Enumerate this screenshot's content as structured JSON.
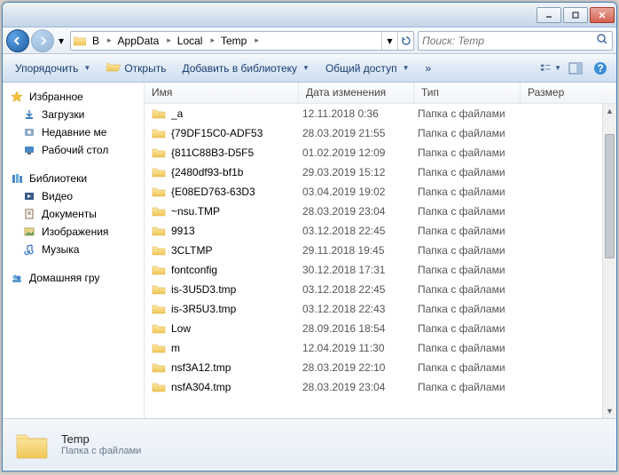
{
  "breadcrumb": [
    "B",
    "AppData",
    "Local",
    "Temp"
  ],
  "search": {
    "placeholder": "Поиск: Temp"
  },
  "toolbar": {
    "organize": "Упорядочить",
    "open": "Открыть",
    "add_to_library": "Добавить в библиотеку",
    "share": "Общий доступ",
    "more": "»"
  },
  "sidebar": {
    "favorites": {
      "label": "Избранное",
      "items": [
        "Загрузки",
        "Недавние ме",
        "Рабочий стол"
      ]
    },
    "libraries": {
      "label": "Библиотеки",
      "items": [
        "Видео",
        "Документы",
        "Изображения",
        "Музыка"
      ]
    },
    "homegroup": {
      "label": "Домашняя гру"
    }
  },
  "columns": {
    "name": "Имя",
    "date": "Дата изменения",
    "type": "Тип",
    "size": "Размер"
  },
  "folder_type": "Папка с файлами",
  "files": [
    {
      "name": "_a",
      "date": "12.11.2018 0:36"
    },
    {
      "name": "{79DF15C0-ADF53",
      "date": "28.03.2019 21:55"
    },
    {
      "name": "{811C88B3-D5F5",
      "date": "01.02.2019 12:09"
    },
    {
      "name": "{2480df93-bf1b",
      "date": "29.03.2019 15:12"
    },
    {
      "name": "{E08ED763-63D3",
      "date": "03.04.2019 19:02"
    },
    {
      "name": "~nsu.TMP",
      "date": "28.03.2019 23:04"
    },
    {
      "name": "9913",
      "date": "03.12.2018 22:45"
    },
    {
      "name": "3CLTMP",
      "date": "29.11.2018 19:45"
    },
    {
      "name": "fontconfig",
      "date": "30.12.2018 17:31"
    },
    {
      "name": "is-3U5D3.tmp",
      "date": "03.12.2018 22:45"
    },
    {
      "name": "is-3R5U3.tmp",
      "date": "03.12.2018 22:43"
    },
    {
      "name": "Low",
      "date": "28.09.2016 18:54"
    },
    {
      "name": "m",
      "date": "12.04.2019 11:30"
    },
    {
      "name": "nsf3A12.tmp",
      "date": "28.03.2019 22:10"
    },
    {
      "name": "nsfA304.tmp",
      "date": "28.03.2019 23:04"
    }
  ],
  "details": {
    "name": "Temp",
    "type": "Папка с файлами"
  }
}
